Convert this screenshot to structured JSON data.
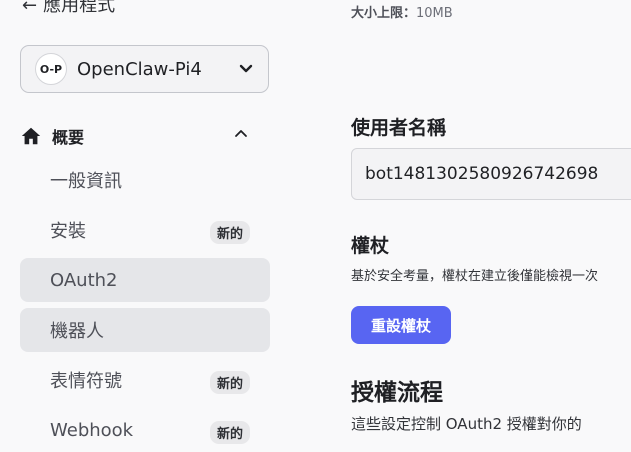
{
  "back": {
    "label": "應用程式"
  },
  "app": {
    "avatar": "O-P",
    "name": "OpenClaw-Pi4"
  },
  "section": {
    "title": "概要"
  },
  "nav": [
    {
      "label": "一般資訊",
      "badge": ""
    },
    {
      "label": "安裝",
      "badge": "新的"
    },
    {
      "label": "OAuth2",
      "badge": ""
    },
    {
      "label": "機器人",
      "badge": ""
    },
    {
      "label": "表情符號",
      "badge": "新的"
    },
    {
      "label": "Webhook",
      "badge": "新的"
    }
  ],
  "main": {
    "size_limit_label": "大小上限：",
    "size_limit_value": "10MB",
    "username_label": "使用者名稱",
    "username_value": "bot1481302580926742698",
    "token_label": "權杖",
    "token_desc": "基於安全考量，權杖在建立後僅能檢視一次",
    "reset_button": "重設權杖",
    "flow_title": "授權流程",
    "flow_desc": "這些設定控制 OAuth2 授權對你的"
  }
}
